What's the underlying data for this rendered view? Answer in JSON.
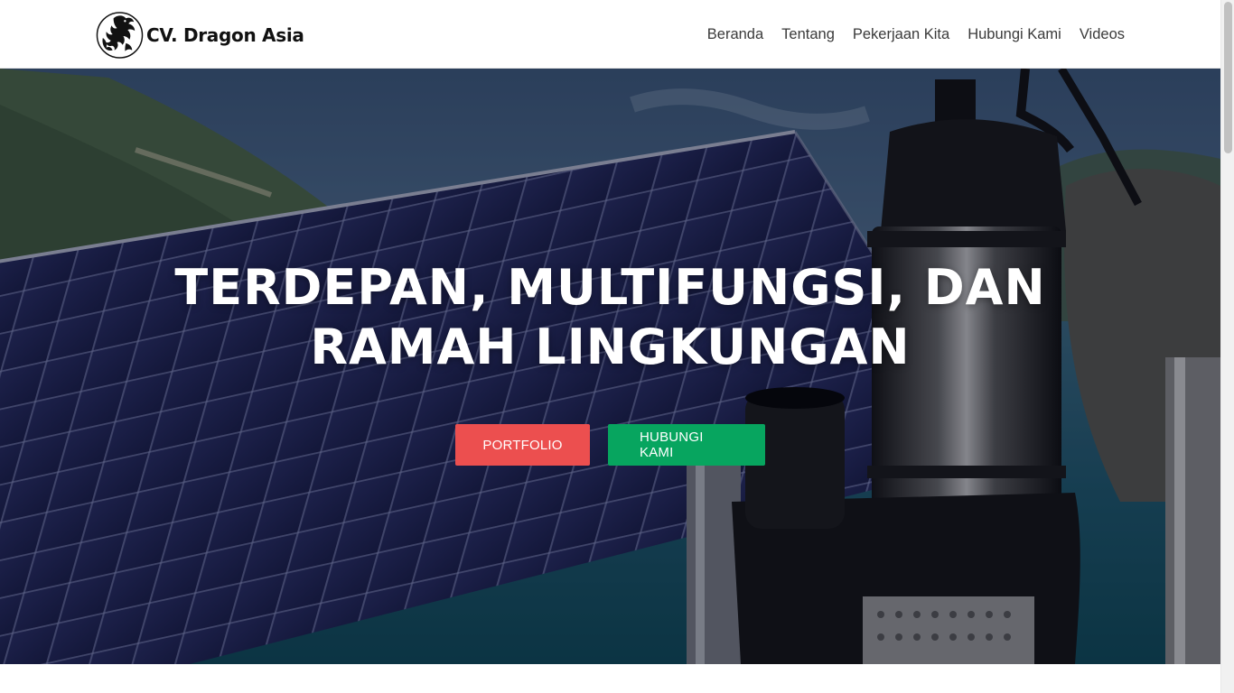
{
  "header": {
    "brand": {
      "name": "CV. Dragon Asia",
      "logo_icon": "dragon-logo-icon"
    },
    "nav": [
      {
        "label": "Beranda"
      },
      {
        "label": "Tentang"
      },
      {
        "label": "Pekerjaan Kita"
      },
      {
        "label": "Hubungi Kami"
      },
      {
        "label": "Videos"
      }
    ]
  },
  "hero": {
    "title": "TERDEPAN, MULTIFUNGSI, DAN RAMAH LINGKUNGAN",
    "background": "solar-panel-and-submersible-pump-photo",
    "buttons": {
      "portfolio": {
        "label": "Portfolio",
        "color": "#ec4f4f"
      },
      "contact": {
        "label": "Hubungi Kami",
        "color": "#07a55f"
      }
    }
  },
  "scrollbar": {
    "visible": true
  }
}
